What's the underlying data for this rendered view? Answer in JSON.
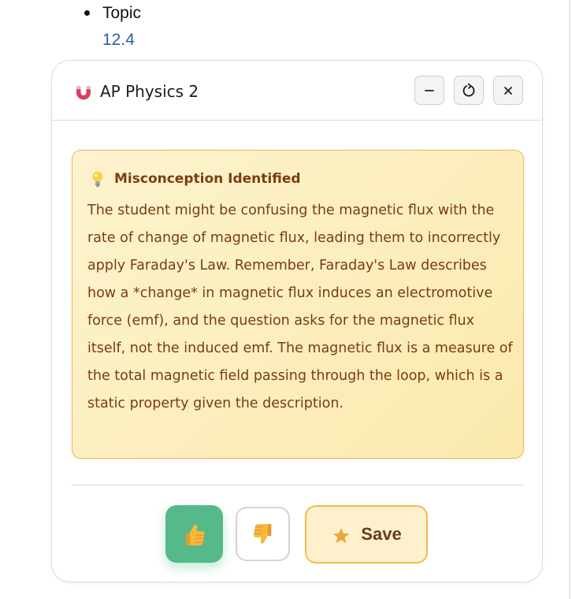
{
  "background": {
    "topic_label": "Topic",
    "topic_value": "12.4"
  },
  "card": {
    "title": "AP Physics 2",
    "header_icons": [
      "magnet-icon"
    ],
    "controls": {
      "minimize_icon": "minus-icon",
      "refresh_icon": "refresh-icon",
      "close_icon": "close-icon"
    },
    "misconception": {
      "icon": "lightbulb-icon",
      "title": "Misconception Identified",
      "body": "The student might be confusing the magnetic flux with the rate of change of magnetic flux, leading them to incorrectly apply Faraday's Law. Remember, Faraday's Law describes how a *change* in magnetic flux induces an electromotive force (emf), and the question asks for the magnetic flux itself, not the induced emf. The magnetic flux is a measure of the total magnetic field passing through the loop, which is a static property given the description."
    },
    "actions": {
      "thumbs_up_icon": "thumbs-up-icon",
      "thumbs_down_icon": "thumbs-down-icon",
      "save_icon": "star-icon",
      "save_label": "Save"
    }
  },
  "colors": {
    "accent_green": "#55b98a",
    "warning_bg": "#fbe9ad",
    "warning_border": "#e9b866",
    "warning_text": "#7a3b14",
    "link_blue": "#2b5ea8",
    "save_border": "#eebd4c"
  }
}
